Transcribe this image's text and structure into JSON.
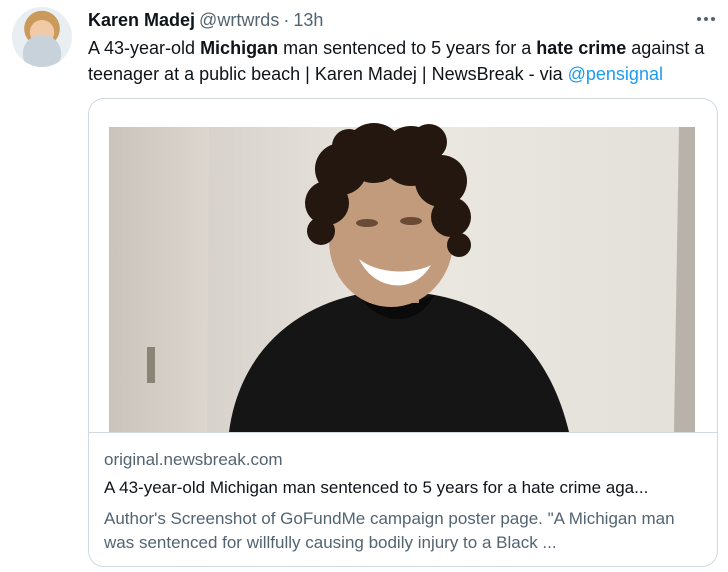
{
  "tweet": {
    "author": {
      "name": "Karen Madej",
      "handle": "@wrtwrds",
      "separator": "·",
      "time": "13h"
    },
    "text": {
      "part1": "A 43-year-old ",
      "bold1": "Michigan",
      "part2": " man sentenced to 5 years for a ",
      "bold2": "hate crime",
      "part3": " against a teenager at a public beach | Karen Madej | NewsBreak - via ",
      "mention": "@pensignal"
    },
    "card": {
      "domain": "original.newsbreak.com",
      "title": "A 43-year-old Michigan man sentenced to 5 years for a hate crime aga...",
      "description": "Author's Screenshot of GoFundMe campaign poster page. \"A Michigan man was sentenced for willfully causing bodily injury to a Black ..."
    }
  },
  "colors": {
    "accent": "#1d9bf0",
    "text_primary": "#0f1419",
    "text_secondary": "#536471",
    "border": "#cfd9de"
  },
  "icons": {
    "more": "more-horizontal-icon",
    "avatar": "avatar"
  }
}
